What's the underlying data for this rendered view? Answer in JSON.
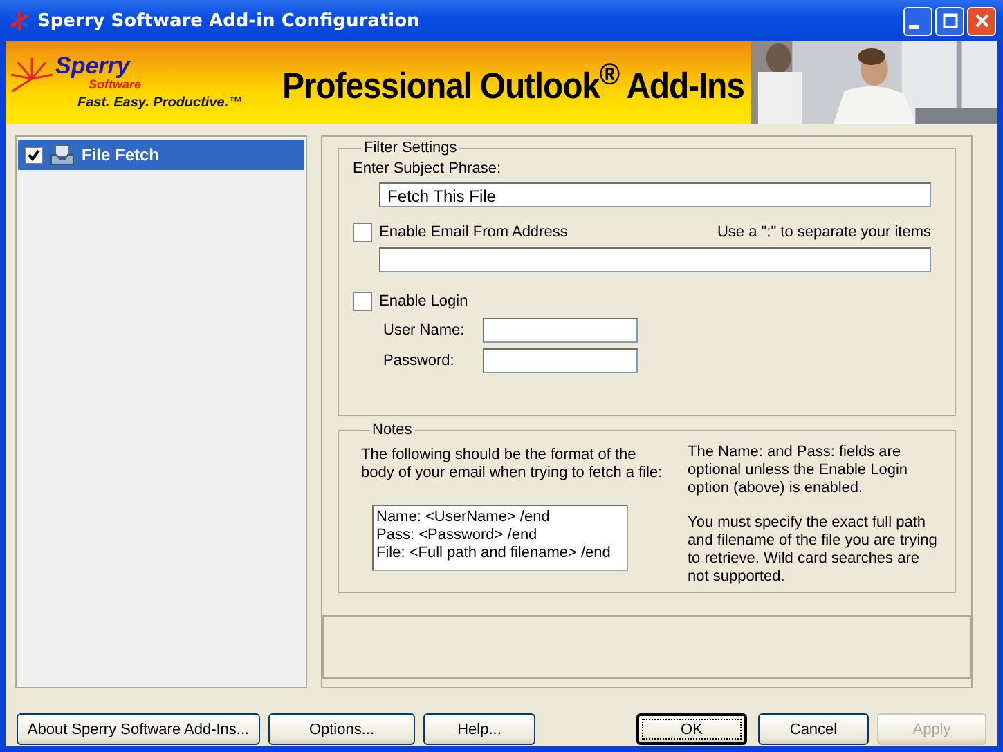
{
  "window": {
    "title": "Sperry Software Add-in Configuration"
  },
  "banner": {
    "logo_name": "Sperry",
    "logo_sub": "Software",
    "tagline": "Fast. Easy. Productive.™",
    "headline": "Professional Outlook$^{®}$ Add-Ins"
  },
  "addins": [
    {
      "label": "File Fetch",
      "checked": true,
      "selected": true
    }
  ],
  "filter_settings": {
    "title": "Filter Settings",
    "subject_label": "Enter Subject Phrase:",
    "subject_value": "Fetch This File",
    "email_checkbox": {
      "label": "Enable Email From Address",
      "checked": false
    },
    "email_hint": "Use a \";\" to separate your items",
    "login_checkbox": {
      "label": "Enable Login",
      "checked": false
    },
    "username_label": "User Name:",
    "password_label": "Password:"
  },
  "notes": {
    "title": "Notes",
    "intro": "The following should be the format of the body of your email when trying to fetch a file:",
    "format_lines": [
      "Name: <UserName> /end",
      "Pass: <Password> /end",
      "File: <Full path and filename> /end"
    ],
    "paragraphs": [
      "The Name: and Pass: fields are optional unless the Enable Login option (above) is enabled.",
      "You must specify the exact full path and filename of the file you are trying to retrieve.   Wild card searches are not supported."
    ]
  },
  "buttons": [
    {
      "label": "About Sperry Software Add-Ins...",
      "disabled": false,
      "default": false
    },
    {
      "label": "Options...",
      "disabled": false,
      "default": false
    },
    {
      "label": "Help...",
      "disabled": false,
      "default": false
    },
    {
      "label": "OK",
      "disabled": false,
      "default": true
    },
    {
      "label": "Cancel",
      "disabled": false,
      "default": false
    },
    {
      "label": "Apply",
      "disabled": true,
      "default": false
    }
  ]
}
